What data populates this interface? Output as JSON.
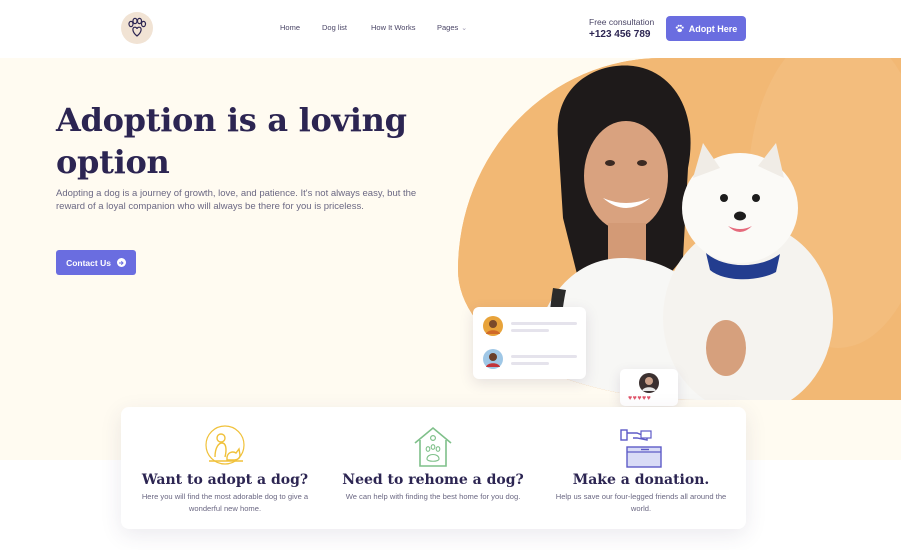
{
  "nav": {
    "logo_icon": "paw-heart-logo",
    "links": [
      {
        "label": "Home"
      },
      {
        "label": "Dog list"
      },
      {
        "label": "How It Works"
      },
      {
        "label": "Pages"
      }
    ],
    "consult_label": "Free consultation",
    "consult_phone": "+123 456 789",
    "adopt_button": "Adopt Here"
  },
  "hero": {
    "title": "Adoption is a loving option",
    "description": "Adopting a dog is a journey of growth, love, and patience. It's not always easy, but the reward of a loyal companion who will always be there for you is priceless.",
    "contact_button": "Contact Us",
    "rating_hearts": "♥♥♥♥♥"
  },
  "services": [
    {
      "title": "Want to adopt a dog?",
      "description": "Here you will find the most adorable dog to give a wonderful new home.",
      "icon": "person-with-dog-icon"
    },
    {
      "title": "Need to rehome a dog?",
      "description": "We can help with finding the best home for you dog.",
      "icon": "dog-house-icon"
    },
    {
      "title": "Make a donation.",
      "description": "Help us save our four-legged friends all around the world.",
      "icon": "donation-box-icon"
    }
  ],
  "colors": {
    "accent": "#6a6de0",
    "hero_bg": "#fffbf1",
    "blob": "#f1b873",
    "heading": "#2c2552",
    "heart": "#e0546a"
  }
}
